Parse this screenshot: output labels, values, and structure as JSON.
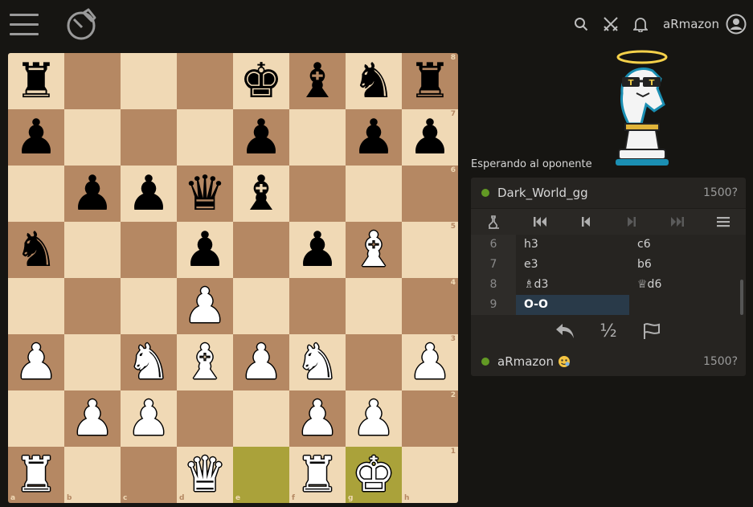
{
  "topbar": {
    "username": "aRmazon"
  },
  "board": {
    "files": [
      "a",
      "b",
      "c",
      "d",
      "e",
      "f",
      "g",
      "h"
    ],
    "ranks": [
      "8",
      "7",
      "6",
      "5",
      "4",
      "3",
      "2",
      "1"
    ],
    "rows": [
      [
        "br",
        "",
        "",
        "",
        "bk",
        "bb",
        "bn",
        "br"
      ],
      [
        "bp",
        "",
        "",
        "",
        "bp",
        "",
        "bp",
        "bp"
      ],
      [
        "",
        "bp",
        "bp",
        "bq",
        "bb",
        "",
        "",
        ""
      ],
      [
        "bn",
        "",
        "",
        "bp",
        "",
        "bp",
        "wb",
        ""
      ],
      [
        "",
        "",
        "",
        "wp",
        "",
        "",
        "",
        ""
      ],
      [
        "wp",
        "",
        "wn",
        "wb",
        "wp",
        "wn",
        "",
        "wp"
      ],
      [
        "",
        "wp",
        "wp",
        "",
        "",
        "wp",
        "wp",
        ""
      ],
      [
        "wr",
        "",
        "",
        "wq",
        "",
        "wr",
        "wk",
        ""
      ]
    ],
    "highlight": [
      "e1",
      "g1"
    ]
  },
  "status_text": "Esperando al oponente",
  "opponent": {
    "name": "Dark_World_gg",
    "rating": "1500?"
  },
  "player": {
    "name": "aRmazon",
    "rating": "1500?"
  },
  "moves": [
    {
      "num": "6",
      "white": "h3",
      "black": "c6"
    },
    {
      "num": "7",
      "white": "e3",
      "black": "b6"
    },
    {
      "num": "8",
      "white": "♗d3",
      "black": "♕d6"
    },
    {
      "num": "9",
      "white": "O-O",
      "black": ""
    }
  ],
  "active_move": "9w",
  "draw_label": "½",
  "colors": {
    "bg": "#161512",
    "panel": "#262421",
    "light_sq": "#f0d9b5",
    "dark_sq": "#b58863",
    "highlight": "#aaa23a",
    "online": "#629924"
  }
}
